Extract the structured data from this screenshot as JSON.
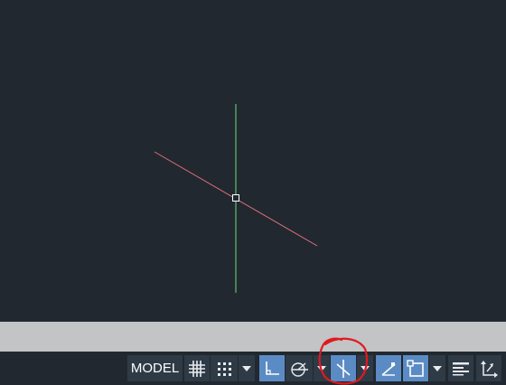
{
  "statusbar": {
    "model_label": "MODEL",
    "items": [
      {
        "name": "model-space-button",
        "active": false
      },
      {
        "name": "grid-icon",
        "active": false
      },
      {
        "name": "snap-icon",
        "active": false
      },
      {
        "name": "snap-dropdown-chevron",
        "active": false
      },
      {
        "name": "ortho-icon",
        "active": true
      },
      {
        "name": "polar-tracking-icon",
        "active": false
      },
      {
        "name": "polar-dropdown-chevron",
        "active": false
      },
      {
        "name": "isometric-drafting-icon",
        "active": true
      },
      {
        "name": "isometric-dropdown-chevron",
        "active": false
      },
      {
        "name": "object-snap-tracking-icon",
        "active": true
      },
      {
        "name": "object-snap-icon",
        "active": true
      },
      {
        "name": "object-snap-dropdown-chevron",
        "active": false
      },
      {
        "name": "lineweight-icon",
        "active": false
      },
      {
        "name": "ucs-icon",
        "active": false
      }
    ]
  },
  "colors": {
    "canvas": "#212830",
    "statusbar_bg": "#212830",
    "statusbar_button": "#2f3a47",
    "statusbar_active": "#5b8bc4",
    "gray_band": "#c2c4c5",
    "cursor_vertical": "#6fdc7a",
    "cursor_horizontal": "#e46f7a",
    "annotation": "#e0191f"
  }
}
